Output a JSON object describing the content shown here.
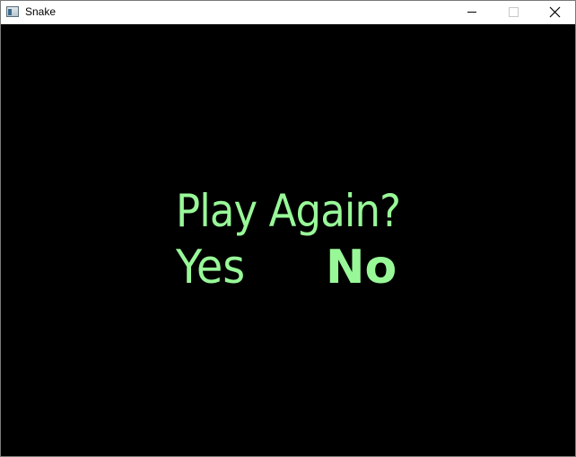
{
  "window": {
    "title": "Snake",
    "icon": "app-window-icon",
    "controls": [
      "minimize-icon",
      "maximize-icon",
      "close-icon"
    ]
  },
  "game": {
    "background": "#000000",
    "text_color": "#98f898",
    "prompt": "Play Again?",
    "options": {
      "yes": "Yes",
      "no": "No"
    }
  }
}
